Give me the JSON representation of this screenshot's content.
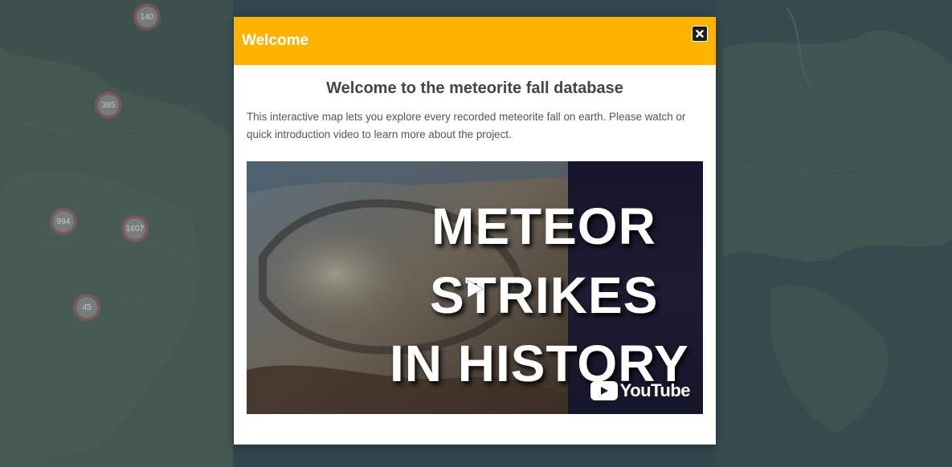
{
  "map": {
    "clusters": [
      {
        "label": "140"
      },
      {
        "label": "385"
      },
      {
        "label": "994"
      },
      {
        "label": "1607"
      },
      {
        "label": "45"
      }
    ]
  },
  "modal": {
    "title": "Welcome",
    "close_icon": "close-icon",
    "headline": "Welcome to the meteorite fall database",
    "intro": "This interactive map lets you explore every recorded meteorite fall on earth. Please watch or quick introduction video to learn more about the project.",
    "video": {
      "line1": "METEOR",
      "line2": "STRIKES",
      "line3": "IN HISTORY",
      "platform": "YouTube",
      "play_icon": "play-icon"
    }
  },
  "colors": {
    "header": "#fdb300",
    "overlay": "#3d4f55"
  }
}
